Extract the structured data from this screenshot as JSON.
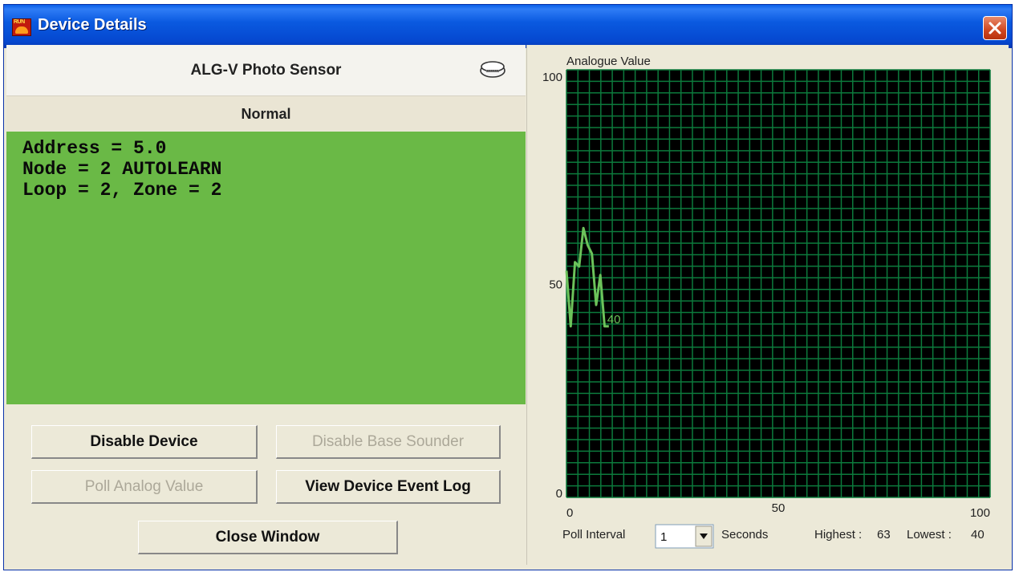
{
  "window": {
    "title": "Device Details"
  },
  "device": {
    "name": "ALG-V Photo Sensor",
    "status": "Normal",
    "info_lines": [
      "Address = 5.0",
      "Node = 2 AUTOLEARN",
      "Loop = 2, Zone = 2"
    ]
  },
  "buttons": {
    "disable_device": "Disable Device",
    "disable_base_sounder": "Disable Base Sounder",
    "poll_analog_value": "Poll Analog Value",
    "view_event_log": "View Device Event Log",
    "close_window": "Close Window"
  },
  "poll": {
    "label": "Poll Interval",
    "value": "1",
    "unit": "Seconds",
    "highest_label": "Highest :",
    "highest": "63",
    "lowest_label": "Lowest :",
    "lowest": "40"
  },
  "colors": {
    "info_bg": "#6ab946",
    "plot_bg": "#000000",
    "grid": "#0c7a3c",
    "series": "#6cc25a"
  },
  "icons": {
    "sensor": "smoke-detector-icon",
    "close": "close-icon",
    "dropdown": "triangle-down-icon"
  },
  "chart_data": {
    "type": "line",
    "title": "Analogue Value",
    "xlim": [
      0,
      100
    ],
    "ylim": [
      0,
      100
    ],
    "x_ticks": [
      "0",
      "50",
      "100"
    ],
    "y_ticks": [
      "0",
      "50",
      "100"
    ],
    "grid": true,
    "series": [
      {
        "x": [
          0,
          1,
          2,
          3,
          4,
          5,
          6,
          7,
          8,
          9,
          10
        ],
        "values": [
          53,
          40,
          55,
          54,
          63,
          59,
          57,
          45,
          52,
          40,
          40
        ]
      }
    ],
    "last_value_label": "40"
  }
}
